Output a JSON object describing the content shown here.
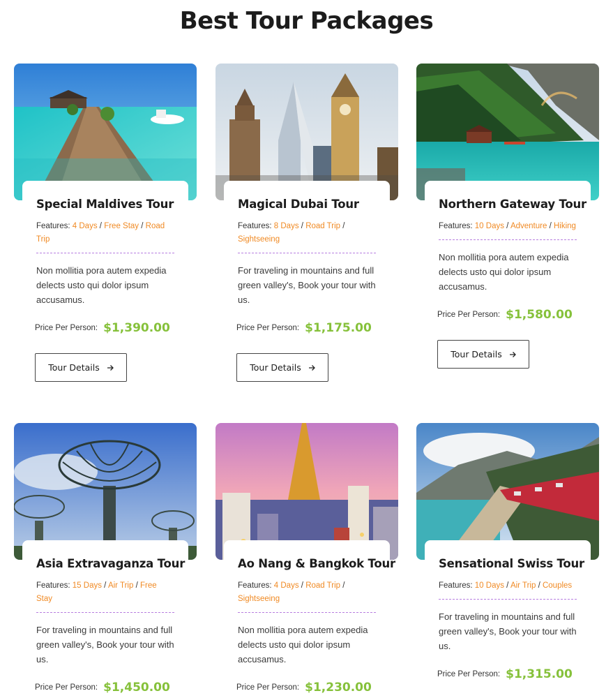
{
  "page": {
    "title": "Best Tour Packages"
  },
  "common": {
    "features_label": "Features:",
    "price_label": "Price Per Person:",
    "details_label": "Tour Details",
    "separator": "/"
  },
  "tours": [
    {
      "title": "Special Maldives Tour",
      "features": [
        "4 Days",
        "Free Stay",
        "Road Trip"
      ],
      "description": "Non mollitia pora autem expedia delects usto qui dolor ipsum accusamus.",
      "price": "$1,390.00",
      "image": "maldives-pier"
    },
    {
      "title": "Magical Dubai Tour",
      "features": [
        "8 Days",
        "Road Trip",
        "Sightseeing"
      ],
      "description": "For traveling in mountains and full green valley's, Book your tour with us.",
      "price": "$1,175.00",
      "image": "dubai-skyline"
    },
    {
      "title": "Northern Gateway Tour",
      "features": [
        "10 Days",
        "Adventure",
        "Hiking"
      ],
      "description": "Non mollitia pora autem expedia delects usto qui dolor ipsum accusamus.",
      "price": "$1,580.00",
      "image": "mountain-lake"
    },
    {
      "title": "Asia Extravaganza Tour",
      "features": [
        "15 Days",
        "Air Trip",
        "Free Stay"
      ],
      "description": "For traveling in mountains and full green valley's, Book your tour with us.",
      "price": "$1,450.00",
      "image": "supertree-grove"
    },
    {
      "title": "Ao Nang & Bangkok Tour",
      "features": [
        "4 Days",
        "Road Trip",
        "Sightseeing"
      ],
      "description": "Non mollitia pora autem expedia delects usto qui dolor ipsum accusamus.",
      "price": "$1,230.00",
      "image": "bangkok-temple"
    },
    {
      "title": "Sensational Swiss Tour",
      "features": [
        "10 Days",
        "Air Trip",
        "Couples"
      ],
      "description": "For traveling in mountains and full green valley's, Book your tour with us.",
      "price": "$1,315.00",
      "image": "swiss-train"
    }
  ],
  "colors": {
    "feature_accent": "#f08a24",
    "price_accent": "#86c13b",
    "divider": "#b77ee0",
    "title": "#1c1c1c"
  }
}
